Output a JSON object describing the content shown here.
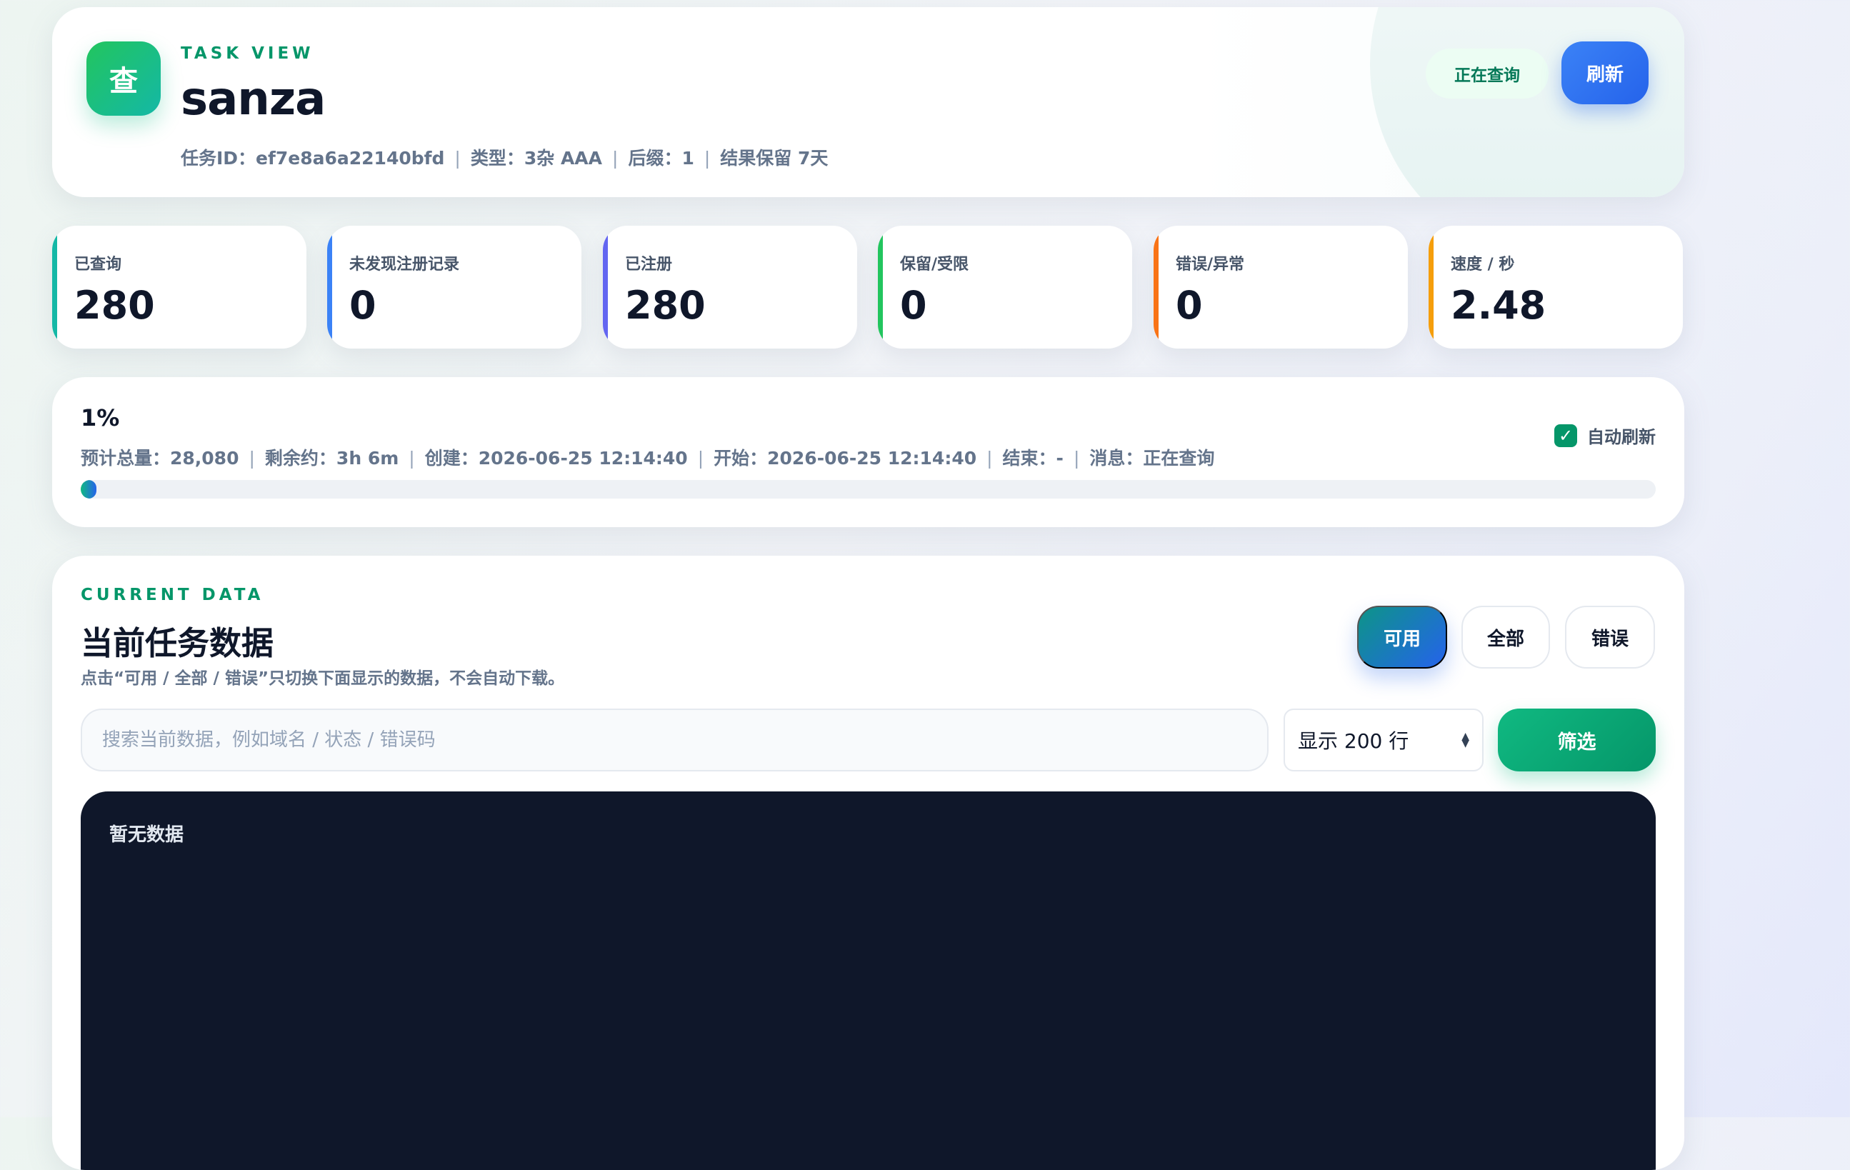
{
  "header": {
    "icon_glyph": "查",
    "eyebrow": "TASK VIEW",
    "title": "sanza",
    "meta": [
      "任务ID：ef7e8a6a22140bfd",
      "类型：3杂 AAA",
      "后缀：1",
      "结果保留 7天"
    ],
    "status": "正在查询",
    "refresh_label": "刷新"
  },
  "stats": [
    {
      "label": "已查询",
      "value": "280",
      "color": "#14b8a6"
    },
    {
      "label": "未发现注册记录",
      "value": "0",
      "color": "#3b82f6"
    },
    {
      "label": "已注册",
      "value": "280",
      "color": "#6366f1"
    },
    {
      "label": "保留/受限",
      "value": "0",
      "color": "#22c55e"
    },
    {
      "label": "错误/异常",
      "value": "0",
      "color": "#f97316"
    },
    {
      "label": "速度 / 秒",
      "value": "2.48",
      "color": "#f59e0b"
    }
  ],
  "progress": {
    "percent_label": "1%",
    "percent_value": 1,
    "meta": [
      "预计总量：28,080",
      "剩余约：3h 6m",
      "创建：2026-06-25 12:14:40",
      "开始：2026-06-25 12:14:40",
      "结束：-",
      "消息：正在查询"
    ],
    "auto_refresh_label": "自动刷新",
    "auto_refresh_checked": true
  },
  "data_panel": {
    "eyebrow": "CURRENT DATA",
    "title": "当前任务数据",
    "hint": "点击“可用 / 全部 / 错误”只切换下面显示的数据，不会自动下载。",
    "filters": [
      "可用",
      "全部",
      "错误"
    ],
    "search_placeholder": "搜索当前数据，例如域名 / 状态 / 错误码",
    "rows_select": "显示 200 行",
    "filter_button": "筛选",
    "empty_text": "暂无数据"
  },
  "colors": {
    "accent_green": "#059669",
    "accent_blue": "#2563eb",
    "console_bg": "#0f172a"
  }
}
